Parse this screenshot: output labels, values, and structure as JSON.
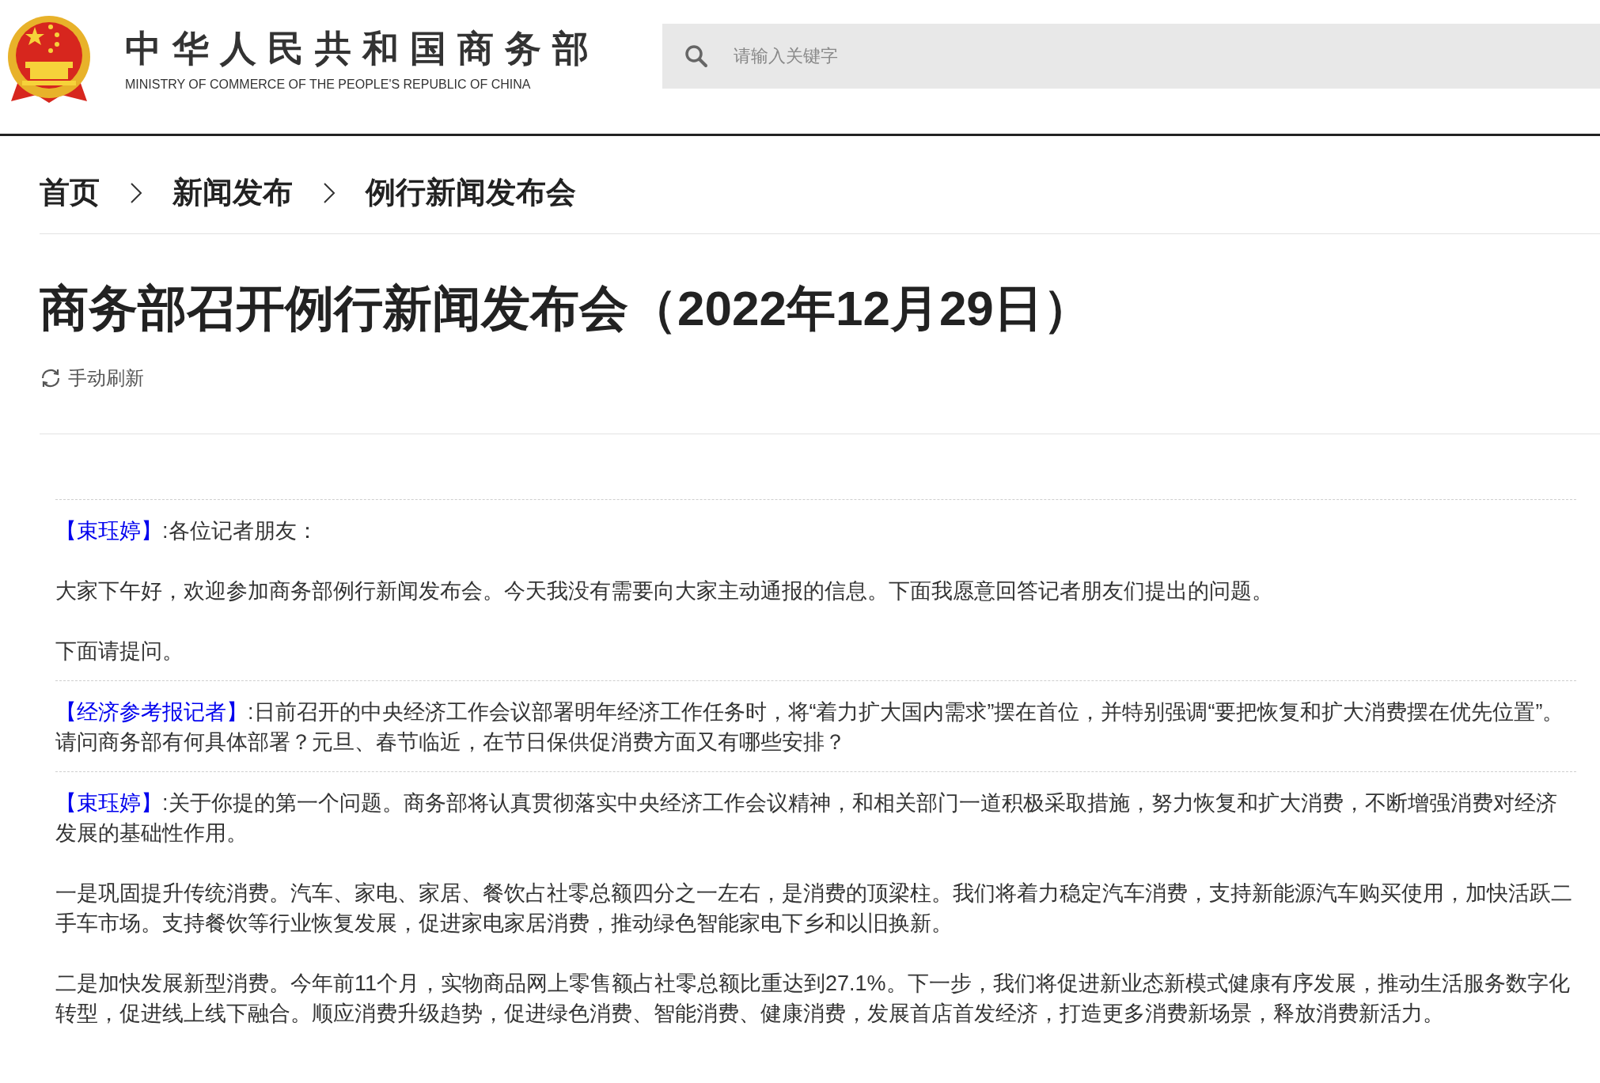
{
  "header": {
    "title": "中华人民共和国商务部",
    "subtitle": "MINISTRY OF COMMERCE OF THE PEOPLE'S REPUBLIC OF CHINA"
  },
  "search": {
    "placeholder": "请输入关键字"
  },
  "breadcrumb": [
    "首页",
    "新闻发布",
    "例行新闻发布会"
  ],
  "article": {
    "title": "商务部召开例行新闻发布会（2022年12月29日）",
    "refresh": "手动刷新"
  },
  "blocks": [
    {
      "kind": "speech",
      "speaker": "【束珏婷】",
      "text": ":各位记者朋友："
    },
    {
      "kind": "paragraph",
      "text": "大家下午好，欢迎参加商务部例行新闻发布会。今天我没有需要向大家主动通报的信息。下面我愿意回答记者朋友们提出的问题。"
    },
    {
      "kind": "paragraph",
      "text": "下面请提问。"
    },
    {
      "kind": "speech",
      "speaker": "【经济参考报记者】",
      "text": ":日前召开的中央经济工作会议部署明年经济工作任务时，将“着力扩大国内需求”摆在首位，并特别强调“要把恢复和扩大消费摆在优先位置”。请问商务部有何具体部署？元旦、春节临近，在节日保供促消费方面又有哪些安排？"
    },
    {
      "kind": "speech",
      "speaker": "【束珏婷】",
      "text": ":关于你提的第一个问题。商务部将认真贯彻落实中央经济工作会议精神，和相关部门一道积极采取措施，努力恢复和扩大消费，不断增强消费对经济发展的基础性作用。"
    },
    {
      "kind": "paragraph",
      "text": "一是巩固提升传统消费。汽车、家电、家居、餐饮占社零总额四分之一左右，是消费的顶梁柱。我们将着力稳定汽车消费，支持新能源汽车购买使用，加快活跃二手车市场。支持餐饮等行业恢复发展，促进家电家居消费，推动绿色智能家电下乡和以旧换新。"
    },
    {
      "kind": "paragraph",
      "text": "二是加快发展新型消费。今年前11个月，实物商品网上零售额占社零总额比重达到27.1%。下一步，我们将促进新业态新模式健康有序发展，推动生活服务数字化转型，促进线上线下融合。顺应消费升级趋势，促进绿色消费、智能消费、健康消费，发展首店首发经济，打造更多消费新场景，释放消费新活力。"
    }
  ]
}
